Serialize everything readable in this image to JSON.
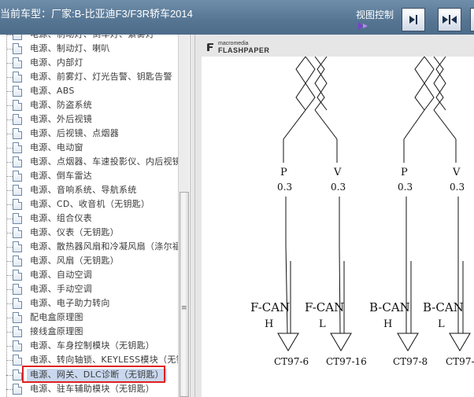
{
  "header": {
    "vehicle_title": "当前车型：厂家:B-比亚迪F3/F3R轿车2014",
    "view_control_label": "视图控制"
  },
  "tree": {
    "items": [
      {
        "label": "电源、制动灯、倒车灯、紫雾灯",
        "selected": false
      },
      {
        "label": "电源、制动灯、喇叭",
        "selected": false
      },
      {
        "label": "电源、内部灯",
        "selected": false
      },
      {
        "label": "电源、前雾灯、灯光告警、钥匙告警",
        "selected": false
      },
      {
        "label": "电源、ABS",
        "selected": false
      },
      {
        "label": "电源、防盗系统",
        "selected": false
      },
      {
        "label": "电源、外后视镜",
        "selected": false
      },
      {
        "label": "电源、后视镜、点烟器",
        "selected": false
      },
      {
        "label": "电源、电动窗",
        "selected": false
      },
      {
        "label": "电源、点烟器、车速投影仪、内后视镜",
        "selected": false
      },
      {
        "label": "电源、倒车雷达",
        "selected": false
      },
      {
        "label": "电源、音响系统、导航系统",
        "selected": false
      },
      {
        "label": "电源、CD、收音机（无钥匙）",
        "selected": false
      },
      {
        "label": "电源、组合仪表",
        "selected": false
      },
      {
        "label": "电源、仪表（无钥匙）",
        "selected": false
      },
      {
        "label": "电源、散热器风扇和冷凝风扇（涤尔福",
        "selected": false
      },
      {
        "label": "电源、风扇（无钥匙）",
        "selected": false
      },
      {
        "label": "电源、自动空调",
        "selected": false
      },
      {
        "label": "电源、手动空调",
        "selected": false
      },
      {
        "label": "电源、电子助力转向",
        "selected": false
      },
      {
        "label": "配电盒原理图",
        "selected": false
      },
      {
        "label": "接线盒原理图",
        "selected": false
      },
      {
        "label": "电源、车身控制模块（无钥匙）",
        "selected": false
      },
      {
        "label": "电源、转向轴锁、KEYLESS模块（无钥",
        "selected": false
      },
      {
        "label": "电源、网关、DLC诊断（无钥匙）",
        "selected": true
      },
      {
        "label": "电源、驻车辅助模块（无钥匙）",
        "selected": false
      }
    ]
  },
  "viewer": {
    "logo_brand": "macromedia",
    "logo_product": "FLASHPAPER"
  },
  "diagram": {
    "wires": [
      {
        "color_code": "P",
        "gauge": "0.3",
        "bus": "F-CAN",
        "pin": "H",
        "connector": "CT97-6"
      },
      {
        "color_code": "V",
        "gauge": "0.3",
        "bus": "F-CAN",
        "pin": "L",
        "connector": "CT97-16"
      },
      {
        "color_code": "P",
        "gauge": "0.3",
        "bus": "B-CAN",
        "pin": "H",
        "connector": "CT97-8"
      },
      {
        "color_code": "V",
        "gauge": "0.3",
        "bus": "B-CAN",
        "pin": "L",
        "connector": "CT97-"
      }
    ]
  }
}
